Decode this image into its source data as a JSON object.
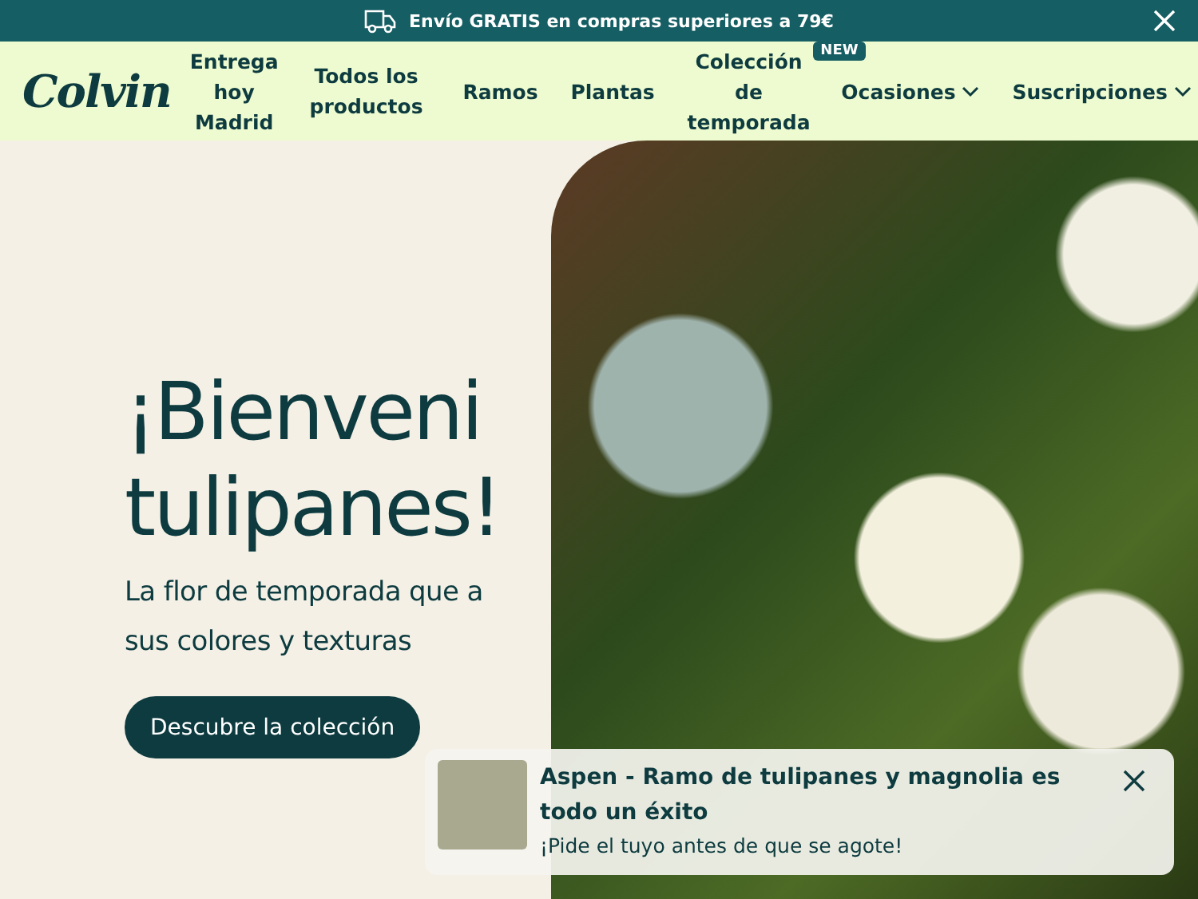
{
  "announcement": {
    "text": "Envío GRATIS en compras superiores a 79€"
  },
  "nav": {
    "logo": "Colvin",
    "items": [
      {
        "label": "Entrega hoy Madrid",
        "kind": "link"
      },
      {
        "label": "Todos los productos",
        "kind": "link"
      },
      {
        "label": "Ramos",
        "kind": "link"
      },
      {
        "label": "Plantas",
        "kind": "link"
      },
      {
        "label": "Colección de temporada",
        "kind": "link",
        "badge": "NEW"
      },
      {
        "label": "Ocasiones",
        "kind": "dropdown"
      },
      {
        "label": "Suscripciones",
        "kind": "dropdown"
      }
    ]
  },
  "hero": {
    "title_lines": [
      "¡Bienveni",
      "tulipanes!"
    ],
    "subtitle_lines": [
      "La flor de temporada que a",
      "sus colores y texturas"
    ],
    "button": "Descubre la colección"
  },
  "toast": {
    "title": "Aspen - Ramo de tulipanes y magnolia es todo un éxito",
    "message": "¡Pide el tuyo antes de que se agote!"
  }
}
